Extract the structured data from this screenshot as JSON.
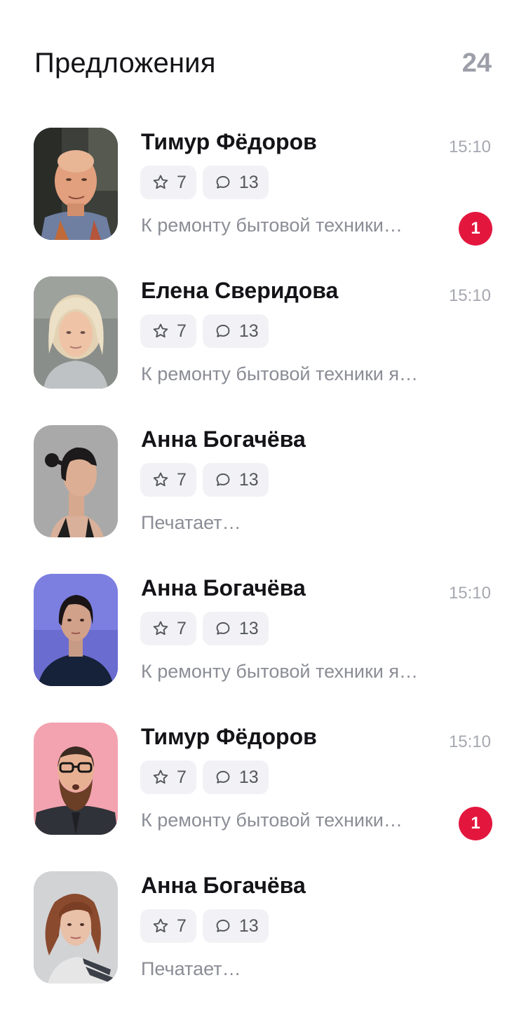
{
  "header": {
    "title": "Предложения",
    "count": "24"
  },
  "offers": [
    {
      "name": "Тимур Фёдоров",
      "time": "15:10",
      "rating": "7",
      "comments": "13",
      "preview": "К ремонту бытовой техники…",
      "unread": "1"
    },
    {
      "name": "Елена Сверидова",
      "time": "15:10",
      "rating": "7",
      "comments": "13",
      "preview": "К ремонту бытовой техники я…",
      "unread": null
    },
    {
      "name": "Анна Богачёва",
      "time": null,
      "rating": "7",
      "comments": "13",
      "preview": "Печатает…",
      "unread": null
    },
    {
      "name": "Анна Богачёва",
      "time": "15:10",
      "rating": "7",
      "comments": "13",
      "preview": "К ремонту бытовой техники я…",
      "unread": null
    },
    {
      "name": "Тимур Фёдоров",
      "time": "15:10",
      "rating": "7",
      "comments": "13",
      "preview": "К ремонту бытовой техники…",
      "unread": "1"
    },
    {
      "name": "Анна Богачёва",
      "time": null,
      "rating": "7",
      "comments": "13",
      "preview": "Печатает…",
      "unread": null
    }
  ],
  "icons": {
    "rating": "star-icon",
    "comments": "chat-bubble-icon"
  },
  "colors": {
    "badge": "#e3173e",
    "muted": "#a6a8b1",
    "chip_bg": "#f2f2f6"
  }
}
